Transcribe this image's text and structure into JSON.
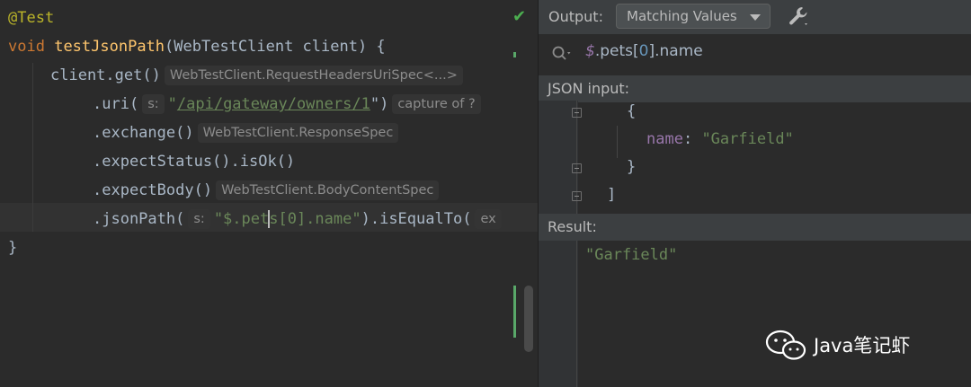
{
  "editor": {
    "annotation": "@Test",
    "kw_void": "void",
    "method_name": "testJsonPath",
    "params": "(WebTestClient client) {",
    "l3_code": "client.get()",
    "l3_hint": "WebTestClient.RequestHeadersUriSpec<...>",
    "l4_code": ".uri(",
    "l4_param": "s:",
    "l4_quote_open": "\"",
    "l4_url": "/api/gateway/owners/1",
    "l4_quote_close": "\")",
    "l4_hint": "capture of ?",
    "l5_code": ".exchange()",
    "l5_hint": "WebTestClient.ResponseSpec",
    "l6_code": ".expectStatus().isOk()",
    "l7_code": ".expectBody()",
    "l7_hint": "WebTestClient.BodyContentSpec",
    "l8_code": ".jsonPath(",
    "l8_param": "s:",
    "l8_str_a": "\"$.pet",
    "l8_str_b": "s[0].name",
    "l8_str_c": "\"",
    "l8_tail": ").isEqualTo(",
    "l8_param2": "ex",
    "l9_code": "}",
    "check_icon": "checkmark-icon"
  },
  "panel": {
    "output_label": "Output:",
    "output_select": "Matching Values",
    "settings_icon": "wrench-icon",
    "query_icon": "search-icon",
    "query_prefix": "$",
    "query_a": ".pets[",
    "query_b": "0",
    "query_c": "].name",
    "json_input_label": "JSON input:",
    "json_l1": "{",
    "json_key": "name",
    "json_colon": ": ",
    "json_value": "\"Garfield\"",
    "json_l3": "}",
    "json_l4": "]",
    "result_label": "Result:",
    "result_value": "\"Garfield\""
  },
  "watermark": {
    "text": "Java笔记虾",
    "icon": "wechat-icon"
  },
  "colors": {
    "background": "#2b2b2b",
    "keyword": "#cc7832",
    "annotation": "#bbb529",
    "function": "#ffc66d",
    "string": "#6a8759",
    "json_key": "#9876aa"
  }
}
